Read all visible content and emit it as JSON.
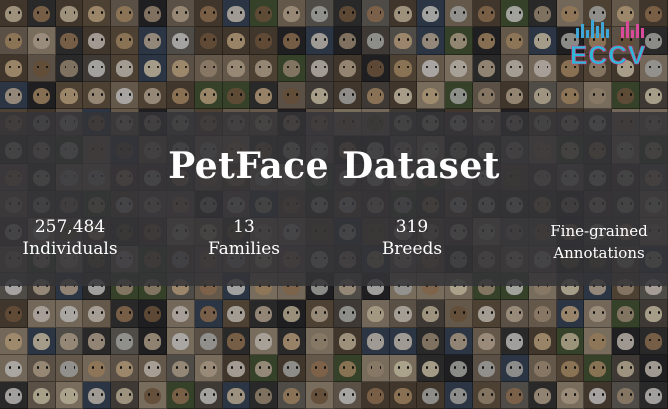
{
  "title": "PetFace Dataset",
  "stats": [
    {
      "value": "257,484",
      "label": "Individuals"
    },
    {
      "value": "13",
      "label": "Families"
    },
    {
      "value": "319",
      "label": "Breeds"
    },
    {
      "value": "Fine-grained",
      "label": "Annotations"
    }
  ],
  "logo": {
    "text": "ECCV",
    "colors": [
      "#2fb7d6",
      "#d93a8f"
    ]
  },
  "colors": {
    "band": "#343438",
    "text": "#ffffff"
  }
}
